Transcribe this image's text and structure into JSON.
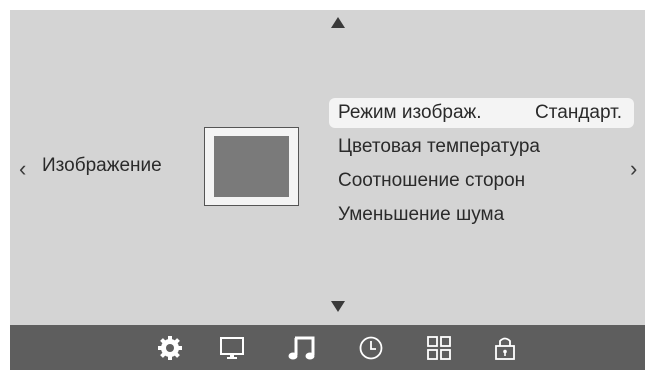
{
  "category": {
    "label": "Изображение"
  },
  "menu": {
    "items": [
      {
        "label": "Режим изображ.",
        "value": "Стандарт.",
        "selected": true
      },
      {
        "label": "Цветовая температура"
      },
      {
        "label": "Соотношение сторон"
      },
      {
        "label": "Уменьшение шума"
      }
    ]
  },
  "nav": {
    "left": "‹",
    "right": "›"
  },
  "bottom_bar": {
    "icons": [
      "settings-gear-icon",
      "monitor-icon",
      "music-note-icon",
      "clock-icon",
      "apps-grid-icon",
      "lock-icon"
    ],
    "active": "music-note-icon"
  },
  "colors": {
    "screen_bg": "#d4d4d4",
    "bar_bg": "#5e5e5e",
    "selected_bg": "#f4f4f4",
    "icon": "#ffffff"
  }
}
